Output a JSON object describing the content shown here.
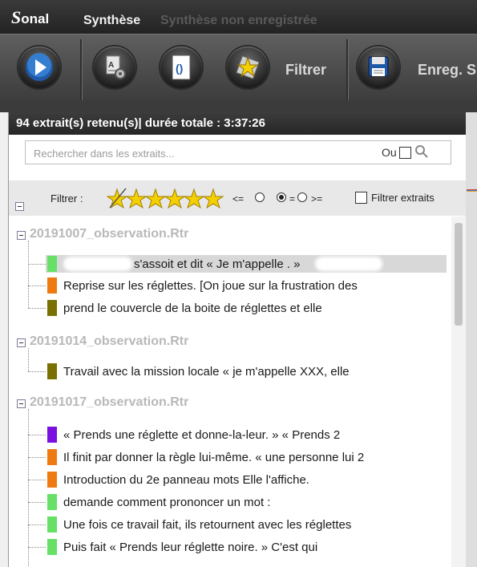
{
  "window": {
    "app_name_initial": "S",
    "app_name_rest": "onal",
    "title": "Synthèse",
    "subtitle": "Synthèse non enregistrée"
  },
  "toolbar": {
    "buttons": [
      {
        "icon": "play-icon"
      },
      {
        "icon": "filter-settings-icon"
      },
      {
        "icon": "document-icon"
      },
      {
        "icon": "star-filter-icon",
        "label": "Filtrer"
      },
      {
        "icon": "save-icon",
        "label": "Enreg. S"
      }
    ]
  },
  "panel": {
    "header": "94 extrait(s) retenu(s)| durée totale : 3:37:26",
    "search_placeholder": "Rechercher dans les extraits...",
    "ou_label": "Ou",
    "filter_label": "Filtrer :",
    "star_count": 5,
    "lte_symbol": "<=",
    "eq_symbol": "=",
    "gte_symbol": ">=",
    "filter_extracts_label": "Filtrer extraits"
  },
  "files": [
    {
      "name": "20191007_observation.Rtr",
      "items": [
        {
          "color": "#66e066",
          "text": "s'assoit et dit « Je m'appelle                        . »",
          "selected": true
        },
        {
          "color": "#f07a12",
          "text": "Reprise sur les réglettes. [On joue sur la frustration des"
        },
        {
          "color": "#7a7000",
          "text": "                    prend le couvercle de la boite de réglettes et elle"
        }
      ]
    },
    {
      "name": "20191014_observation.Rtr",
      "items": [
        {
          "color": "#7a7000",
          "text": "Travail avec la mission locale « je m'appelle XXX, elle"
        }
      ]
    },
    {
      "name": "20191017_observation.Rtr",
      "items": [
        {
          "color": "#7a10e0",
          "text": "« Prends une réglette et donne-la-leur. » « Prends 2"
        },
        {
          "color": "#f07a12",
          "text": " Il finit par donner la règle lui-même. « une personne lui 2"
        },
        {
          "color": "#f07a12",
          "text": "Introduction du 2e panneau mots Elle l'affiche."
        },
        {
          "color": "#66e066",
          "text": "                 demande comment prononcer un mot :"
        },
        {
          "color": "#66e066",
          "text": "Une fois ce travail fait, ils retournent avec les réglettes"
        },
        {
          "color": "#66e066",
          "text": "Puis     fait « Prends leur réglette noire. » C'est               qui"
        }
      ]
    }
  ],
  "colors": {
    "accent_bar": [
      "#d94040",
      "#3a7ad9",
      "#e0a020",
      "#40a060"
    ]
  }
}
